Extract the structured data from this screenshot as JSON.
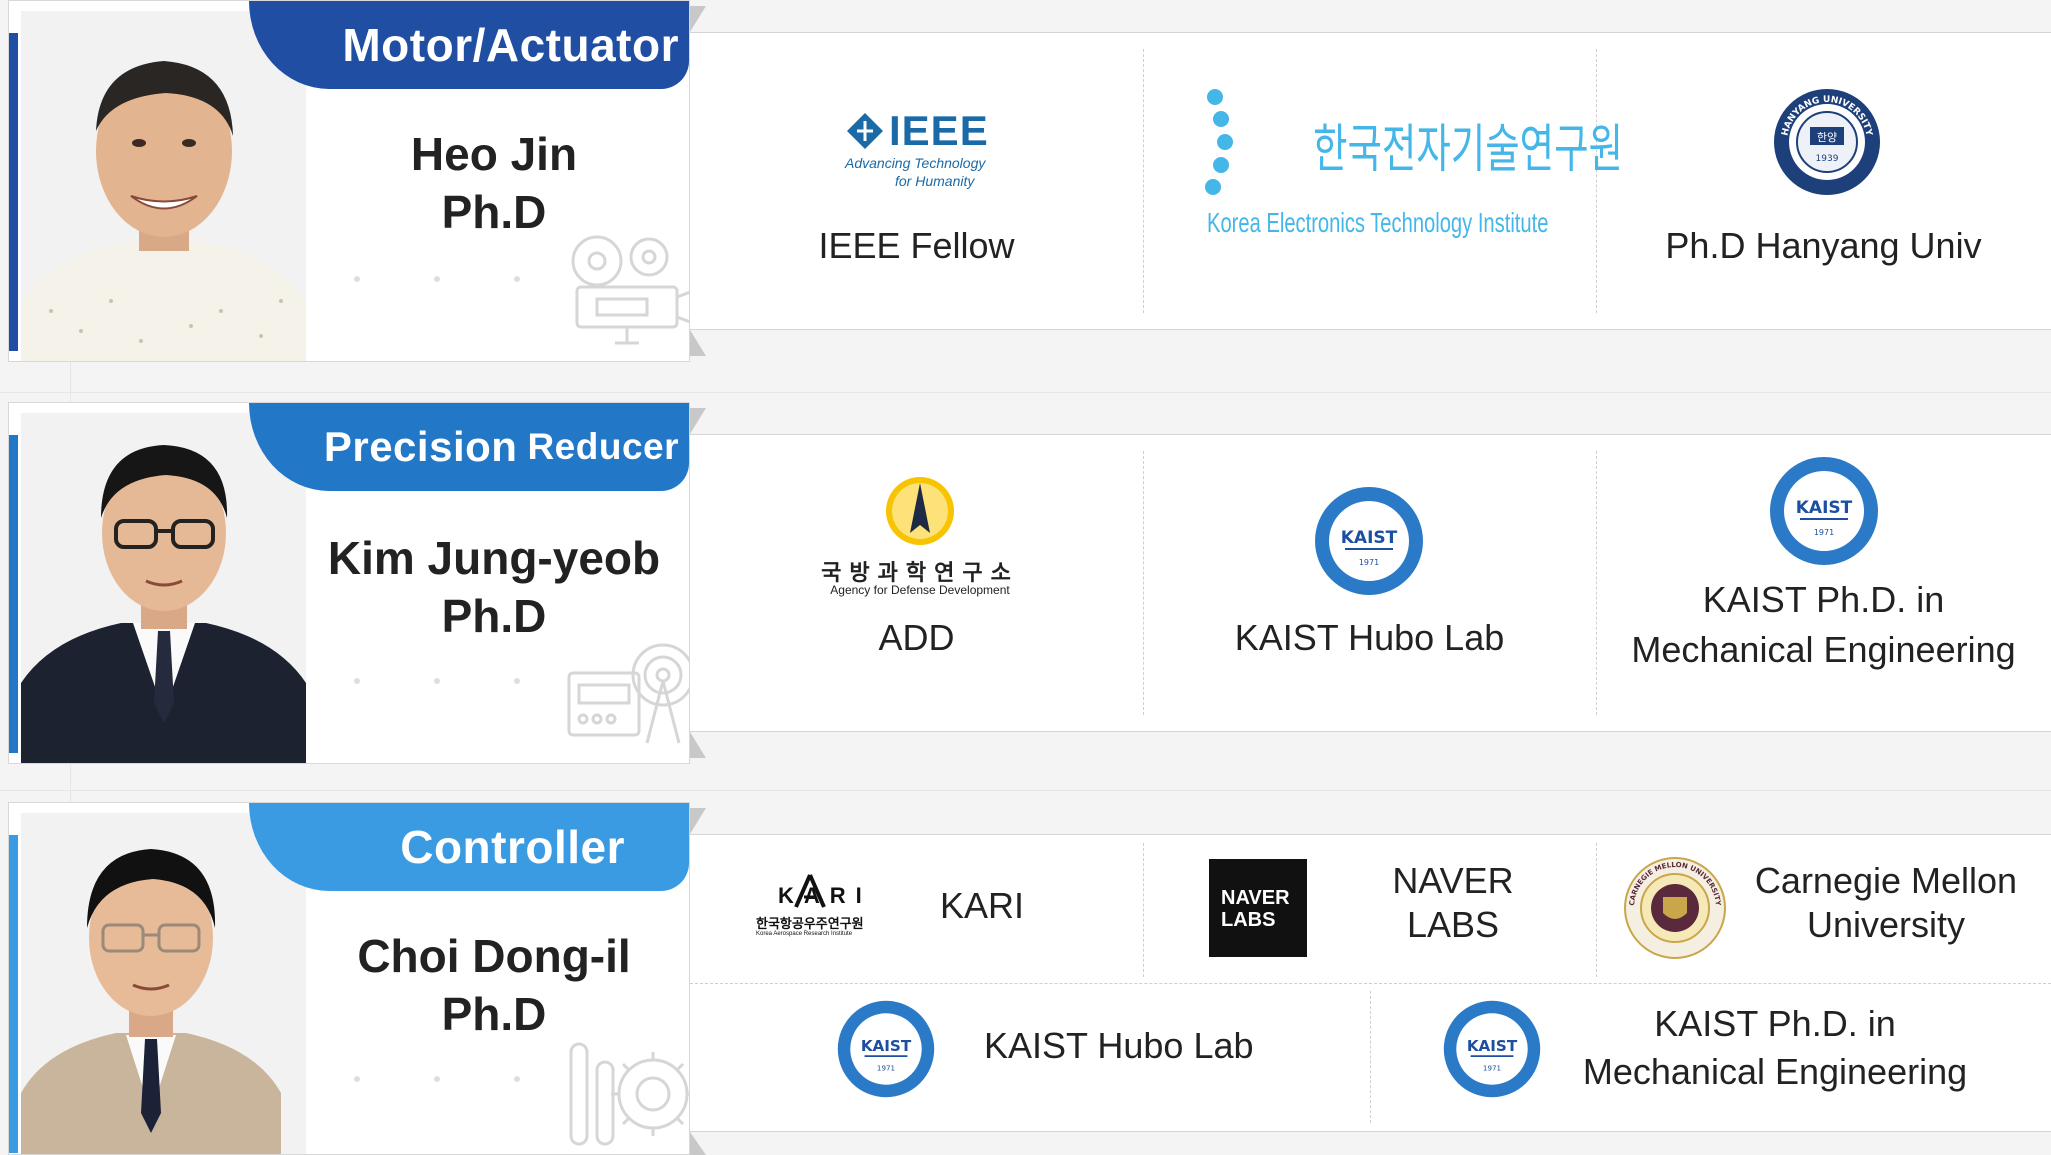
{
  "rows": [
    {
      "category": "Motor/Actuator",
      "category_suffix": "",
      "name": "Heo Jin",
      "degree": "Ph.D",
      "tab_color": "#1f4ea3",
      "items": [
        {
          "logo_main": "IEEE",
          "logo_sub1": "Advancing Technology",
          "logo_sub2": "for Humanity",
          "label": "IEEE Fellow"
        },
        {
          "logo_main": "한국전자기술연구원",
          "logo_sub1": "Korea Electronics Technology Institute",
          "label": ""
        },
        {
          "logo_main": "HANYANG UNIVERSITY",
          "logo_sub1": "한양",
          "logo_sub2": "1939",
          "label": "Ph.D Hanyang Univ"
        }
      ]
    },
    {
      "category": "Precision",
      "category_suffix": "Reducer",
      "name": "Kim Jung-yeob",
      "degree": "Ph.D",
      "tab_color": "#2277c7",
      "items": [
        {
          "logo_main": "국방과학연구소",
          "logo_sub1": "Agency for Defense Development",
          "label": "ADD"
        },
        {
          "logo_main": "KAIST",
          "logo_sub1": "1971",
          "label": "KAIST Hubo Lab"
        },
        {
          "logo_main": "KAIST",
          "logo_sub1": "1971",
          "label_line1": "KAIST  Ph.D. in",
          "label_line2": "Mechanical Engineering"
        }
      ]
    },
    {
      "category": "Controller",
      "category_suffix": "",
      "name": "Choi Dong-il",
      "degree": "Ph.D",
      "tab_color": "#3a9be3",
      "items": [
        {
          "logo_main": "KARI",
          "logo_sub1": "한국항공우주연구원",
          "logo_sub2": "Korea Aerospace Research Institute",
          "label": "KARI"
        },
        {
          "logo_main": "NAVER",
          "logo_sub1": "LABS",
          "label_line1": "NAVER",
          "label_line2": "LABS"
        },
        {
          "logo_main": "CARNEGIE MELLON UNIVERSITY",
          "label_line1": "Carnegie Mellon",
          "label_line2": "University"
        },
        {
          "logo_main": "KAIST",
          "logo_sub1": "1971",
          "label": "KAIST Hubo Lab"
        },
        {
          "logo_main": "KAIST",
          "logo_sub1": "1971",
          "label_line1": "KAIST  Ph.D. in",
          "label_line2": "Mechanical Engineering"
        }
      ]
    }
  ]
}
